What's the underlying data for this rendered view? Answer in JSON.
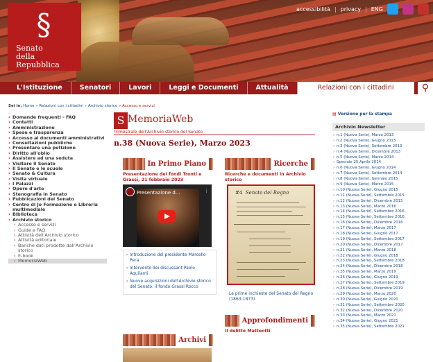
{
  "header": {
    "logo_name": "Senato\ndella Repubblica",
    "utility": {
      "accessibility": "accessibilità",
      "privacy": "privacy",
      "lang": "ENG"
    }
  },
  "nav": {
    "items": [
      "L'Istituzione",
      "Senatori",
      "Lavori",
      "Leggi e Documenti",
      "Attualità",
      "Relazioni con i cittadini"
    ],
    "active": "Relazioni con i cittadini"
  },
  "breadcrumb": {
    "prefix": "Sei in:",
    "items": [
      "Home",
      "Relazioni con i cittadini",
      "Archivio storico",
      "Accesso e servizi"
    ]
  },
  "sidebar": {
    "items": [
      "Domande frequenti - FAQ",
      "Contatti",
      "Amministrazione",
      "Spese e trasparenza",
      "Accesso ai documenti amministrativi",
      "Consultazioni pubbliche",
      "Presentare una petizione",
      "Diritto all'oblio",
      "Assistere ad una seduta",
      "Visitare il Senato",
      "Il Senato e le scuole",
      "Senato & Cultura",
      "Visita virtuale",
      "I Palazzi",
      "Opere d'arte",
      "Stenografia in Senato",
      "Pubblicazioni del Senato",
      "Centro di Jo Formazione e Libreria multimediale",
      "Biblioteca",
      "Archivio storico"
    ],
    "sub": [
      "Accesso e servizi",
      "Guide e FAQ",
      "Attività dell'Archivio storico",
      "Attività editoriale",
      "Banche dati prodotte dall'Archivio storico",
      "E-book",
      "MemoriaWeb"
    ]
  },
  "main": {
    "logo_mark": "S",
    "title": "MemoriaWeb",
    "subtitle": "Trimestrale dell'Archivio storico del Senato",
    "issue": "n.38 (Nuova Serie), Marzo 2023",
    "primo_piano": "In Primo Piano",
    "primo_headline": "Presentazione dei fondi Tronti e Grassi, 21 febbraio 2023",
    "video_title": "Presentazione d...",
    "links": [
      "Introduzione del presidente Marcello Pera",
      "Intervento dei discussant Paolo Aquilanti",
      "Nuove acquisizioni dell'Archivio storico del Senato: il fondo Grassi Rocco"
    ],
    "ricerche": "Ricerche",
    "ricerche_headline": "Ricerche e documenti in Archivio storico",
    "scan_title": "Senato del Regno",
    "scan_num": "#4",
    "ricerche_link": "Le prime inchieste del Senato del Regno (1863-1873)",
    "archivi": "Archivi",
    "approfondimenti": "Approfondimenti",
    "approf_sub": "Il delitto Matteotti"
  },
  "right": {
    "print": "Versione per la stampa",
    "archive_title": "Archivio Newsletter",
    "archive": [
      "n.1 (Nuova Serie), Marzo 2013",
      "n.2 (Nuova Serie), Giugno 2013",
      "n.3 (Nuova Serie), Settembre 2013",
      "n.4 (Nuova Serie), Dicembre 2013",
      "n.5 (Nuova Serie), Marzo 2014",
      "Speciale 25 Aprile 2014",
      "n.6 (Nuova Serie), Giugno 2014",
      "n.7 (Nuova Serie), Settembre 2014",
      "n.8 (Nuova Serie), Gennaio 2015",
      "n.9 (Nuova Serie), Marzo 2015",
      "n.10 (Nuova Serie), Giugno 2015",
      "n.11 (Nuova Serie), Settembre 2015",
      "n.12 (Nuova Serie), Dicembre 2015",
      "n.13 (Nuova Serie), Marzo 2016",
      "n.14 (Nuova Serie), Settembre 2016",
      "n.15 (Nuova Serie), Settembre 2016",
      "n.16 (Nuova Serie), Dicembre 2016",
      "n.17 (Nuova Serie), Marzo 2017",
      "n.18 (Nuova Serie), Giugno 2017",
      "n.19 (Nuova Serie), Settembre 2017",
      "n.20 (Nuova Serie), Dicembre 2017",
      "n.21 (Nuova Serie), Marzo 2018",
      "n.22 (Nuova Serie), Giugno 2018",
      "n.23 (Nuova Serie), Settembre 2018",
      "n.24 (Nuova Serie), Dicembre 2018",
      "n.25 (Nuova Serie), Marzo 2019",
      "n.26 (Nuova Serie), Giugno 2019",
      "n.27 (Nuova Serie), Settembre 2019",
      "n.28 (Nuova Serie), Dicembre 2019",
      "n.29 (Nuova Serie), Marzo 2020",
      "n.30 (Nuova Serie), Giugno 2020",
      "n.31 (Nuova Serie), Settembre 2020",
      "n.32 (Nuova Serie), Dicembre 2020",
      "n.33 (Nuova Serie), Marzo 2021",
      "n.34 (Nuova Serie), Giugno 2021",
      "n.35 (Nuova Serie), Settembre 2021"
    ]
  },
  "colors": {
    "brand": "#b71c1c",
    "nav": "#9b1a1a",
    "link": "#1a4c8c"
  }
}
